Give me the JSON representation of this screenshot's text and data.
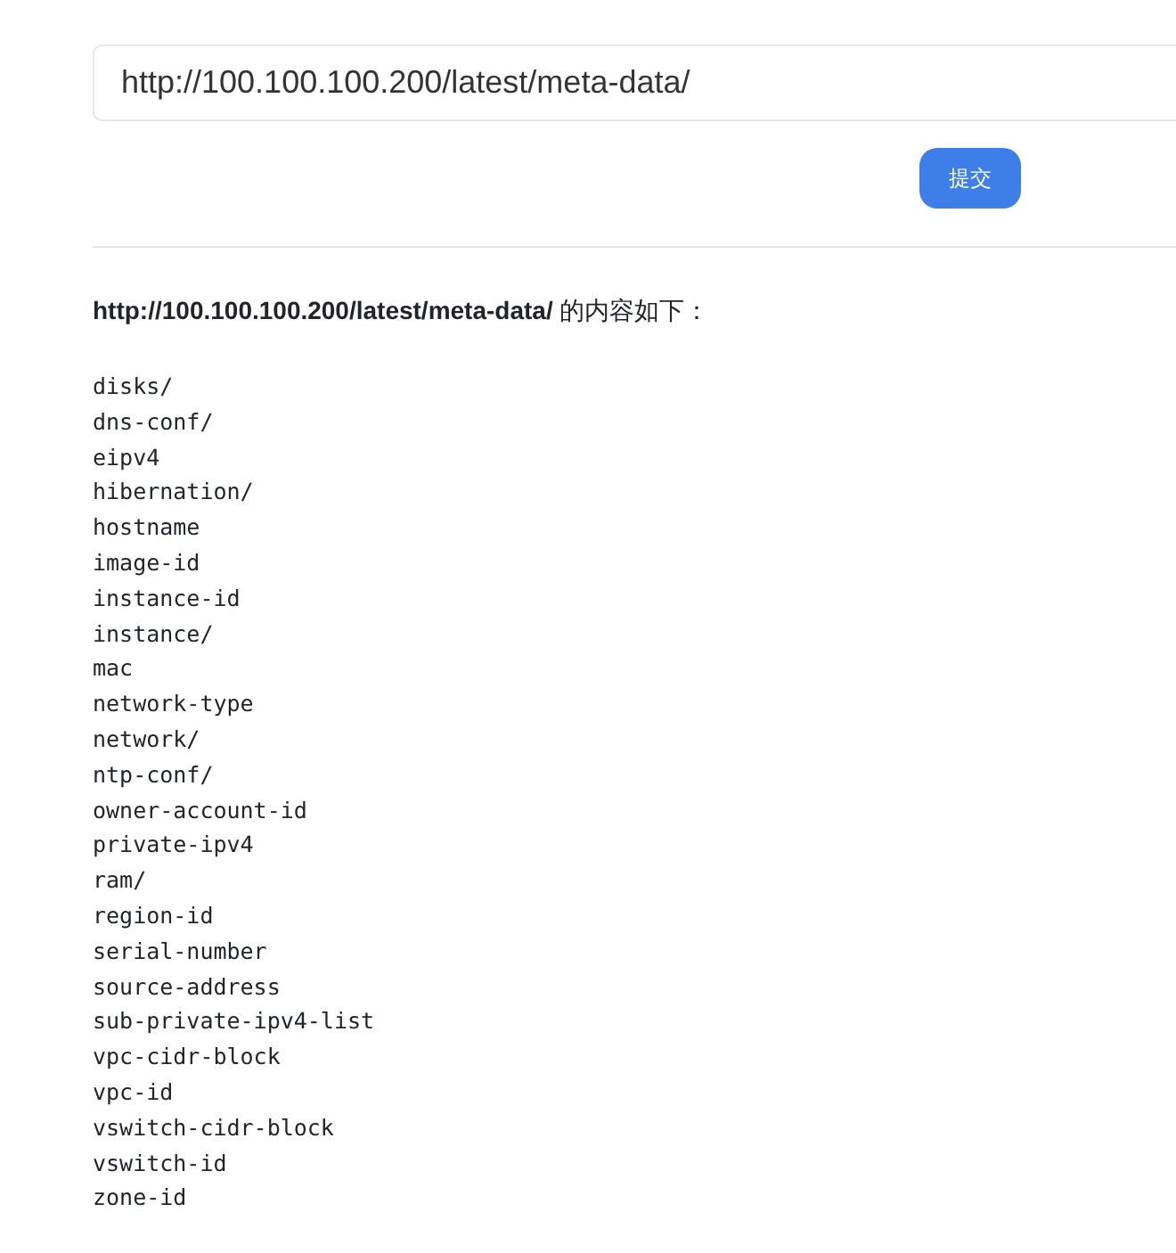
{
  "url_field": {
    "value": "http://100.100.100.200/latest/meta-data/"
  },
  "submit_button": "提交",
  "result_heading": "**http://100.100.100.200/latest/meta-data/** 的内容如下：",
  "result_lines": [
    "disks/",
    "dns-conf/",
    "eipv4",
    "hibernation/",
    "hostname",
    "image-id",
    "instance-id",
    "instance/",
    "mac",
    "network-type",
    "network/",
    "ntp-conf/",
    "owner-account-id",
    "private-ipv4",
    "ram/",
    "region-id",
    "serial-number",
    "source-address",
    "sub-private-ipv4-list",
    "vpc-cidr-block",
    "vpc-id",
    "vswitch-cidr-block",
    "vswitch-id",
    "zone-id"
  ]
}
